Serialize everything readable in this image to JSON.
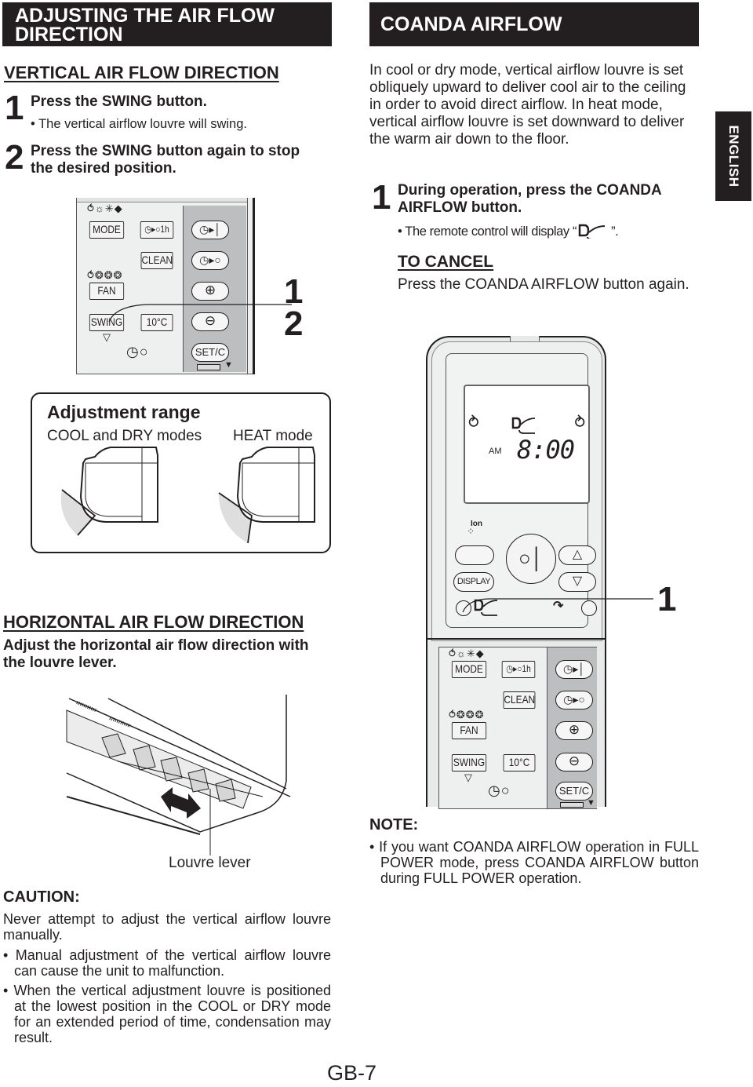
{
  "left": {
    "header": "ADJUSTING THE AIR FLOW DIRECTION",
    "vertical": {
      "title": "VERTICAL AIR FLOW DIRECTION",
      "steps": [
        {
          "num": "1",
          "text": "Press the SWING button.",
          "bullet": "• The vertical airflow louvre will swing."
        },
        {
          "num": "2",
          "text": "Press the SWING button again to stop the desired position."
        }
      ],
      "callout_nums": [
        "1",
        "2"
      ]
    },
    "adjustment_range": {
      "title": "Adjustment range",
      "labels": [
        "COOL and DRY modes",
        "HEAT mode"
      ]
    },
    "horizontal": {
      "title": "HORIZONTAL AIR FLOW DIRECTION",
      "text": "Adjust the horizontal air flow direction with the louvre lever.",
      "figure_label": "Louvre lever"
    },
    "caution": {
      "title": "CAUTION:",
      "text": "Never attempt to adjust the vertical airflow louvre manually.",
      "bullets": [
        "• Manual adjustment of the vertical airflow louvre can cause the unit to malfunction.",
        "• When the vertical adjustment louvre is positioned at the lowest position in the COOL or DRY mode for an extended period of time, condensation may result."
      ]
    }
  },
  "right": {
    "header": "COANDA AIRFLOW",
    "intro": "In cool or dry mode, vertical airflow louvre is set obliquely upward to deliver cool air to the ceiling in order to avoid direct airflow. In heat mode, vertical airflow louvre is set downward to deliver the warm air down to the floor.",
    "step": {
      "num": "1",
      "text": "During operation, press the COANDA AIRFLOW button.",
      "bullet_prefix": "• The remote control will display “",
      "bullet_suffix": "”."
    },
    "cancel": {
      "title": "TO CANCEL",
      "text": "Press the COANDA AIRFLOW button again."
    },
    "callout_num": "1",
    "note": {
      "title": "NOTE:",
      "bullets": [
        "• If you want COANDA AIRFLOW operation in FULL POWER mode, press COANDA AIRFLOW button during FULL POWER operation."
      ]
    }
  },
  "side_tab": "ENGLISH",
  "page_number": "GB-7",
  "remote": {
    "lcd": {
      "am": "AM",
      "time": "8:00"
    },
    "ion_label": "Ion",
    "display_label": "DISPLAY",
    "buttons": {
      "mode": "MODE",
      "timer_1h": "1h",
      "clean": "CLEAN",
      "fan": "FAN",
      "swing": "SWING",
      "temp": "10°C",
      "setc": "SET/C",
      "plus": "+",
      "minus": "−"
    }
  }
}
